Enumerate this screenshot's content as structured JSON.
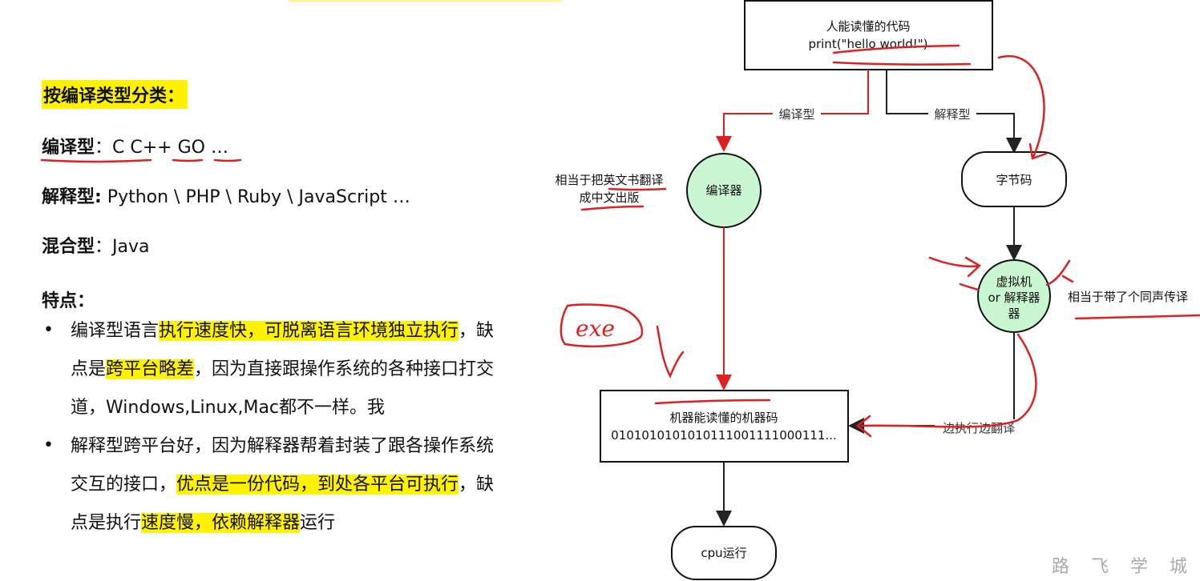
{
  "notes": {
    "heading": "按编译类型分类：",
    "compiled_label": "编译型",
    "compiled_langs": "：C  C++  GO  …",
    "interpreted_label": "解释型:",
    "interpreted_langs": " Python \\ PHP \\ Ruby \\ JavaScript …",
    "hybrid_label": "混合型",
    "hybrid_langs": "：Java",
    "features_title": "特点：",
    "bullet_symbol": "•",
    "f1_a": "编译型语言",
    "f1_b": "执行速度快，可脱离语言环境独立执行",
    "f1_c": "，缺",
    "f1_d": "点是",
    "f1_e": "跨平台略差",
    "f1_f": "，因为直接跟操作系统的各种接口打交",
    "f1_g": "道，Windows,Linux,Mac都不一样。我",
    "f2_a": "解释型跨平台好，因为解释器帮着封装了跟各操作系统",
    "f2_b": "交互的接口，",
    "f2_c": "优点是一份代码，到处各平台可执行",
    "f2_d": "，缺",
    "f2_e": "点是执行",
    "f2_f": "速度慢，依赖解释器",
    "f2_g": "运行"
  },
  "diagram": {
    "source_line1": "人能读懂的代码",
    "source_line2": "print(\"hello world!\")",
    "edge_compile": "编译型",
    "edge_interpret": "解释型",
    "compiler": "编译器",
    "compiler_note_1": "相当于把英文书翻译",
    "compiler_note_2": "成中文出版",
    "bytecode": "字节码",
    "vm_1": "虚拟机",
    "vm_2": "or 解释器",
    "vm_3": "器",
    "vm_note": "相当于带了个同声传译",
    "machine_1": "机器能读懂的机器码",
    "machine_2": "0101010101010111001111000111...",
    "edge_exec": "边执行边翻译",
    "cpu": "cpu运行",
    "handwritten_exe": "exe"
  },
  "watermark": "路 飞 学 城",
  "colors": {
    "highlight": "#fff200",
    "red": "#e02020",
    "node_green": "#c9f7d2"
  }
}
